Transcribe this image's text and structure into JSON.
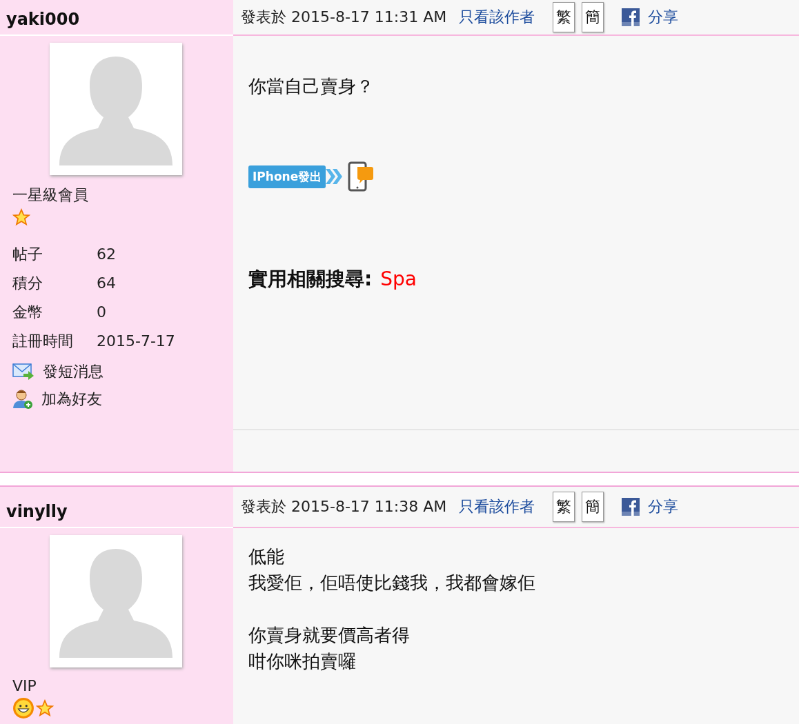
{
  "posts": [
    {
      "author": "yaki000",
      "posted": "發表於 2015-8-17 11:31 AM",
      "author_only_link": "只看該作者",
      "convert_buttons": [
        "繁",
        "簡"
      ],
      "share": "分享",
      "rank": "一星級會員",
      "rank_icons": [
        {
          "kind": "star"
        }
      ],
      "stats": [
        {
          "label": "帖子",
          "value": "62"
        },
        {
          "label": "積分",
          "value": "64"
        },
        {
          "label": "金幣",
          "value": "0"
        },
        {
          "label": "註冊時間",
          "value": "2015-7-17"
        }
      ],
      "actions": [
        {
          "kind": "message",
          "label": "發短消息"
        },
        {
          "kind": "friend",
          "label": "加為好友"
        }
      ],
      "content": [
        {
          "kind": "text",
          "lines": [
            "你當自己賣身？"
          ]
        },
        {
          "kind": "badge",
          "text": "IPhone發出"
        },
        {
          "kind": "related",
          "label": "實用相關搜尋:",
          "link": "Spa"
        }
      ],
      "footer": true
    },
    {
      "author": "vinylly",
      "posted": "發表於 2015-8-17 11:38 AM",
      "author_only_link": "只看該作者",
      "convert_buttons": [
        "繁",
        "簡"
      ],
      "share": "分享",
      "rank": "VIP",
      "rank_icons": [
        {
          "kind": "sun"
        },
        {
          "kind": "star"
        }
      ],
      "content": [
        {
          "kind": "text",
          "lines": [
            "低能",
            "我愛佢，佢唔使比錢我，我都會嫁佢"
          ]
        },
        {
          "kind": "text",
          "lines": [
            "你賣身就要價高者得",
            "咁你咪拍賣囉"
          ]
        }
      ],
      "footer": false
    }
  ]
}
